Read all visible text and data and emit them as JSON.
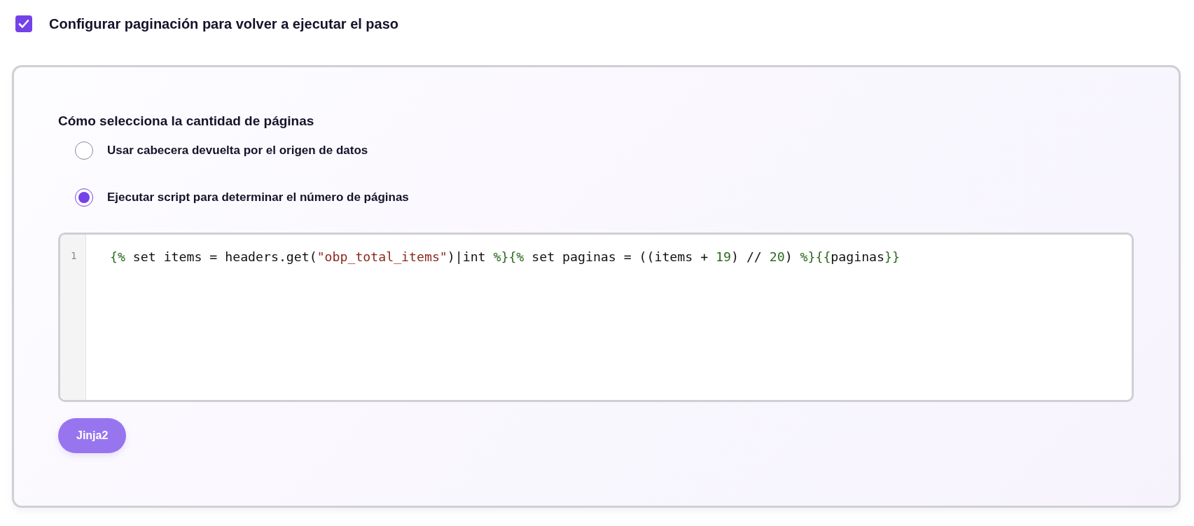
{
  "pagination_toggle": {
    "label": "Configurar paginación para volver a ejecutar el paso",
    "checked": true
  },
  "panel": {
    "heading": "Cómo selecciona la cantidad de páginas",
    "options": [
      {
        "label": "Usar cabecera devuelta por el origen de datos",
        "selected": false
      },
      {
        "label": "Ejecutar script para determinar el número de páginas",
        "selected": true
      }
    ],
    "editor": {
      "lines": [
        {
          "number": "1",
          "tokens": [
            {
              "kind": "delim",
              "text": "{%"
            },
            {
              "kind": "plain",
              "text": " set items = headers.get("
            },
            {
              "kind": "string",
              "text": "\"obp_total_items\""
            },
            {
              "kind": "plain",
              "text": ")|int "
            },
            {
              "kind": "delim",
              "text": "%}{%"
            },
            {
              "kind": "plain",
              "text": " set paginas = ((items + "
            },
            {
              "kind": "number",
              "text": "19"
            },
            {
              "kind": "plain",
              "text": ") // "
            },
            {
              "kind": "number",
              "text": "20"
            },
            {
              "kind": "plain",
              "text": ") "
            },
            {
              "kind": "delim",
              "text": "%}{{"
            },
            {
              "kind": "plain",
              "text": "paginas"
            },
            {
              "kind": "delim",
              "text": "}}"
            }
          ]
        }
      ]
    },
    "language_button": "Jinja2"
  }
}
